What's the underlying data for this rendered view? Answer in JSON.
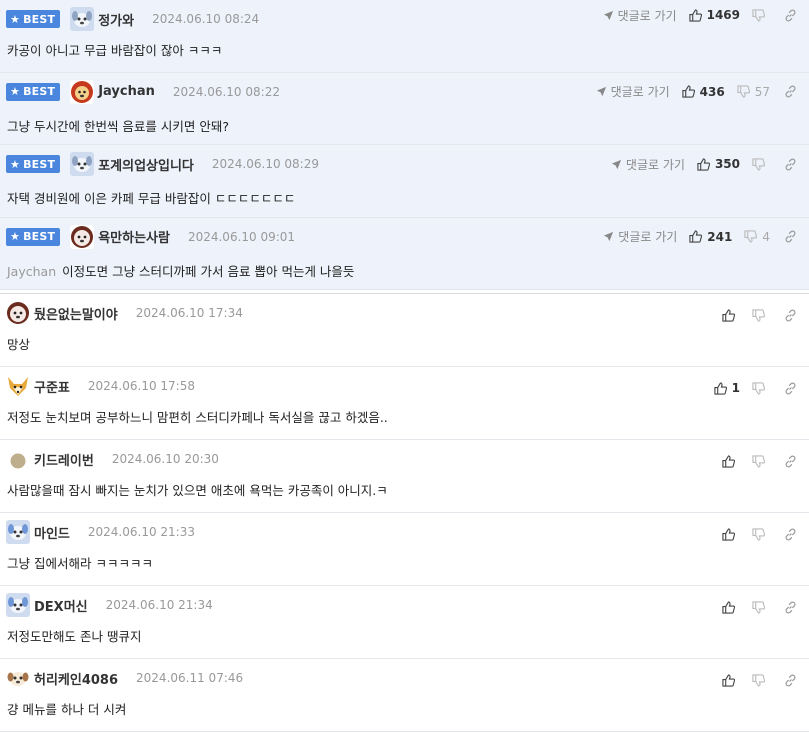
{
  "best_label": "BEST",
  "reply_label": "댓글로 가기",
  "best_comments": [
    {
      "nickname": "정가와",
      "date": "2024.06.10 08:24",
      "mention": "",
      "text": "카공이 아니고 무급 바람잡이 잖아 ㅋㅋㅋ",
      "likes": "1469",
      "dislikes": "",
      "avatar": "puppy-icon"
    },
    {
      "nickname": "Jaychan",
      "date": "2024.06.10 08:22",
      "mention": "",
      "text": "그냥 두시간에 한번씩 음료를 시키면 안돼?",
      "likes": "436",
      "dislikes": "57",
      "avatar": "lion-icon"
    },
    {
      "nickname": "포계의업상입니다",
      "date": "2024.06.10 08:29",
      "mention": "",
      "text": "자택 경비원에 이은 카페 무급 바람잡이 ㄷㄷㄷㄷㄷㄷㄷ",
      "likes": "350",
      "dislikes": "",
      "avatar": "puppy-icon"
    },
    {
      "nickname": "욕만하는사람",
      "date": "2024.06.10 09:01",
      "mention": "Jaychan",
      "text": "이정도면 그냥 스터디까페 가서 음료 뽑아 먹는게 나을듯",
      "likes": "241",
      "dislikes": "4",
      "avatar": "dog-icon"
    }
  ],
  "comments": [
    {
      "nickname": "뒀은없는말이야",
      "date": "2024.06.10 17:34",
      "text": "망상",
      "likes": "",
      "avatar": "dog-icon"
    },
    {
      "nickname": "구준표",
      "date": "2024.06.10 17:58",
      "text": "저정도 눈치보며 공부하느니 맘편히 스터디카페나 독서실을 끊고 하겠음..",
      "likes": "1",
      "avatar": "fox-icon"
    },
    {
      "nickname": "키드레이번",
      "date": "2024.06.10 20:30",
      "text": "사람많을때 잠시 빠지는 눈치가 있으면 애초에 욕먹는 카공족이 아니지.ㅋ",
      "likes": "",
      "avatar": "circle-icon"
    },
    {
      "nickname": "마인드",
      "date": "2024.06.10 21:33",
      "text": "그냥 집에서해라 ㅋㅋㅋㅋㅋ",
      "likes": "",
      "avatar": "puppy-icon"
    },
    {
      "nickname": "DEX머신",
      "date": "2024.06.10 21:34",
      "text": "저정도만해도 존나 땡큐지",
      "likes": "",
      "avatar": "puppy-icon"
    },
    {
      "nickname": "허리케인4086",
      "date": "2024.06.11 07:46",
      "text": "걍 메뉴를 하나 더 시켜",
      "likes": "",
      "avatar": "puppy-icon"
    }
  ]
}
